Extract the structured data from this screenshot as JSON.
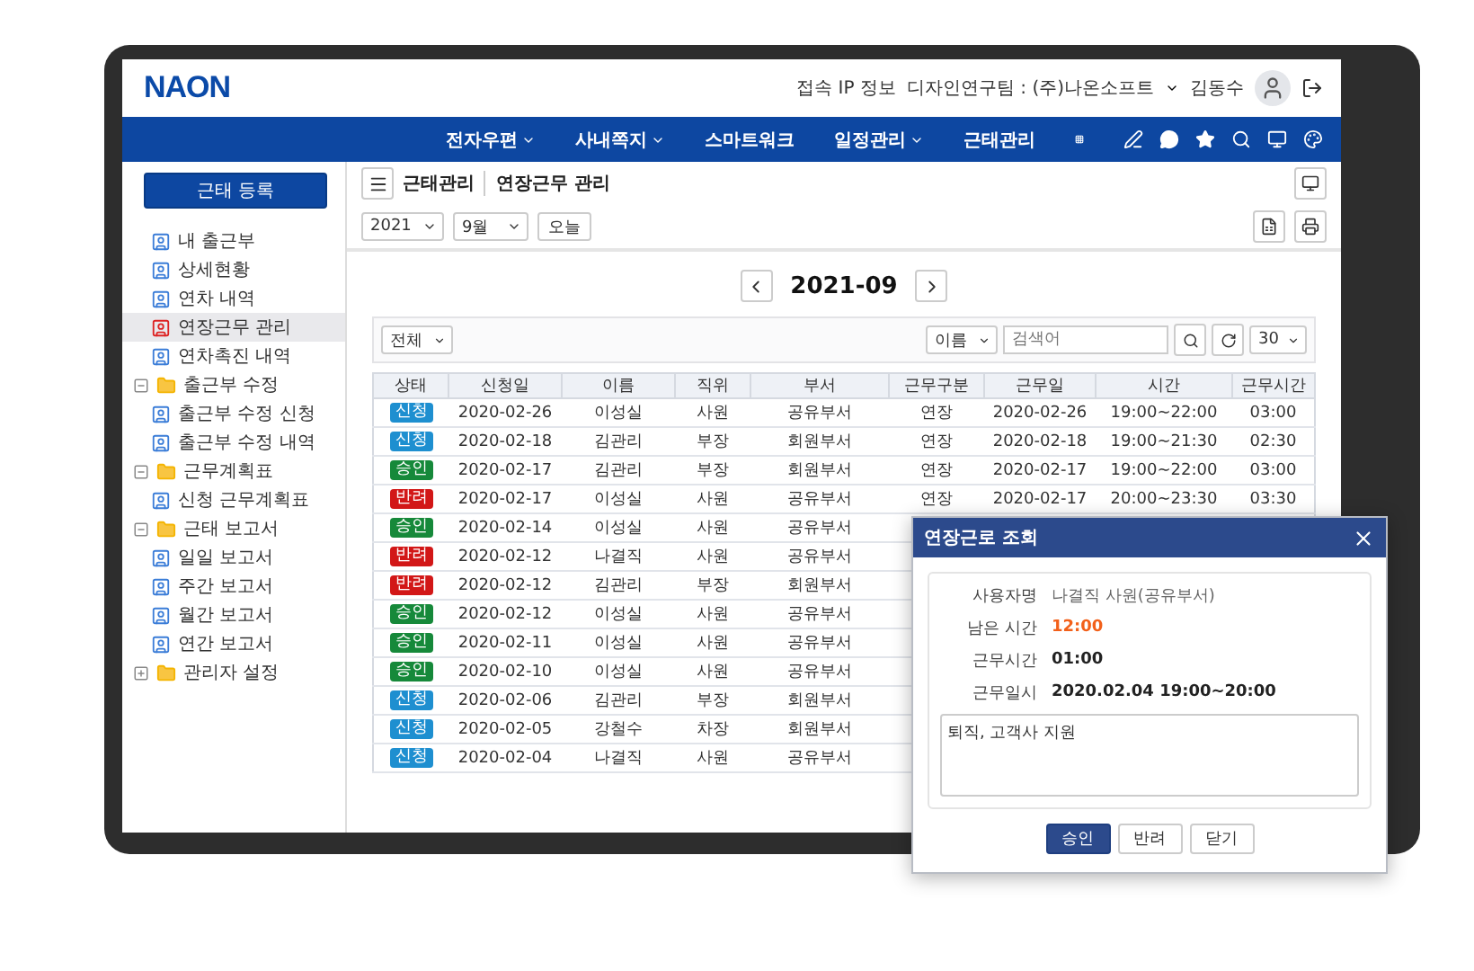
{
  "header": {
    "logo": "NAON",
    "links": [
      "접속 IP 정보",
      "디자인연구팀 : (주)나온소프트"
    ],
    "user_name": "김동수"
  },
  "nav": [
    {
      "label": "전자우편",
      "has_menu": true
    },
    {
      "label": "사내쪽지",
      "has_menu": true
    },
    {
      "label": "스마트워크",
      "has_menu": false
    },
    {
      "label": "일정관리",
      "has_menu": true
    },
    {
      "label": "근태관리",
      "has_menu": false
    }
  ],
  "sidebar": {
    "register_button": "근태 등록",
    "items": [
      {
        "label": "내 출근부",
        "kind": "page",
        "selected": false
      },
      {
        "label": "상세현황",
        "kind": "page",
        "selected": false
      },
      {
        "label": "연차 내역",
        "kind": "page",
        "selected": false
      },
      {
        "label": "연장근무 관리",
        "kind": "page",
        "selected": true
      },
      {
        "label": "연차촉진 내역",
        "kind": "page",
        "selected": false
      },
      {
        "label": "출근부 수정",
        "kind": "folder",
        "expanded": true,
        "selected": false,
        "children": [
          {
            "label": "출근부 수정 신청",
            "selected": false
          },
          {
            "label": "출근부 수정 내역",
            "selected": false
          }
        ]
      },
      {
        "label": "근무계획표",
        "kind": "folder",
        "expanded": true,
        "selected": false,
        "children": [
          {
            "label": "신청 근무계획표",
            "selected": false
          }
        ]
      },
      {
        "label": "근태 보고서",
        "kind": "folder",
        "expanded": true,
        "selected": false,
        "children": [
          {
            "label": "일일 보고서",
            "selected": false
          },
          {
            "label": "주간 보고서",
            "selected": false
          },
          {
            "label": "월간 보고서",
            "selected": false
          },
          {
            "label": "연간 보고서",
            "selected": false
          }
        ]
      },
      {
        "label": "관리자 설정",
        "kind": "folder",
        "expanded": false,
        "selected": false
      }
    ]
  },
  "breadcrumb": [
    "근태관리",
    "연장근무 관리"
  ],
  "toolbar": {
    "year": "2021",
    "month": "9월",
    "today_button": "오늘"
  },
  "period": "2021-09",
  "filter": {
    "scope": "전체",
    "search_by": "이름",
    "search_placeholder": "검색어",
    "page_size": "30"
  },
  "table": {
    "columns": [
      "상태",
      "신청일",
      "이름",
      "직위",
      "부서",
      "근무구분",
      "근무일",
      "시간",
      "근무시간"
    ],
    "rows": [
      {
        "color": "#1e8fd0",
        "cells": [
          "신청",
          "2020-02-26",
          "이성실",
          "사원",
          "공유부서",
          "연장",
          "2020-02-26",
          "19:00~22:00",
          "03:00"
        ]
      },
      {
        "color": "#1e8fd0",
        "cells": [
          "신청",
          "2020-02-18",
          "김관리",
          "부장",
          "회원부서",
          "연장",
          "2020-02-18",
          "19:00~21:30",
          "02:30"
        ]
      },
      {
        "color": "#16893a",
        "cells": [
          "승인",
          "2020-02-17",
          "김관리",
          "부장",
          "회원부서",
          "연장",
          "2020-02-17",
          "19:00~22:00",
          "03:00"
        ]
      },
      {
        "color": "#d21717",
        "cells": [
          "반려",
          "2020-02-17",
          "이성실",
          "사원",
          "공유부서",
          "연장",
          "2020-02-17",
          "20:00~23:30",
          "03:30"
        ]
      },
      {
        "color": "#16893a",
        "cells": [
          "승인",
          "2020-02-14",
          "이성실",
          "사원",
          "공유부서"
        ]
      },
      {
        "color": "#d21717",
        "cells": [
          "반려",
          "2020-02-12",
          "나결직",
          "사원",
          "공유부서"
        ]
      },
      {
        "color": "#d21717",
        "cells": [
          "반려",
          "2020-02-12",
          "김관리",
          "부장",
          "회원부서"
        ]
      },
      {
        "color": "#16893a",
        "cells": [
          "승인",
          "2020-02-12",
          "이성실",
          "사원",
          "공유부서"
        ]
      },
      {
        "color": "#16893a",
        "cells": [
          "승인",
          "2020-02-11",
          "이성실",
          "사원",
          "공유부서"
        ]
      },
      {
        "color": "#16893a",
        "cells": [
          "승인",
          "2020-02-10",
          "이성실",
          "사원",
          "공유부서"
        ]
      },
      {
        "color": "#1e8fd0",
        "cells": [
          "신청",
          "2020-02-06",
          "김관리",
          "부장",
          "회원부서"
        ]
      },
      {
        "color": "#1e8fd0",
        "cells": [
          "신청",
          "2020-02-05",
          "강철수",
          "차장",
          "회원부서"
        ]
      },
      {
        "color": "#1e8fd0",
        "cells": [
          "신청",
          "2020-02-04",
          "나결직",
          "사원",
          "공유부서"
        ]
      }
    ]
  },
  "dialog": {
    "title": "연장근로 조회",
    "fields": [
      {
        "label": "사용자명",
        "value": "나결직 사원(공유부서)",
        "kind": "plain"
      },
      {
        "label": "남은 시간",
        "value": "12:00",
        "kind": "highlight"
      },
      {
        "label": "근무시간",
        "value": "01:00",
        "kind": "strong"
      },
      {
        "label": "근무일시",
        "value": "2020.02.04 19:00~20:00",
        "kind": "strong"
      }
    ],
    "note": "퇴직, 고객사 지원",
    "buttons": [
      {
        "label": "승인",
        "primary": true
      },
      {
        "label": "반려",
        "primary": false
      },
      {
        "label": "닫기",
        "primary": false
      }
    ]
  }
}
